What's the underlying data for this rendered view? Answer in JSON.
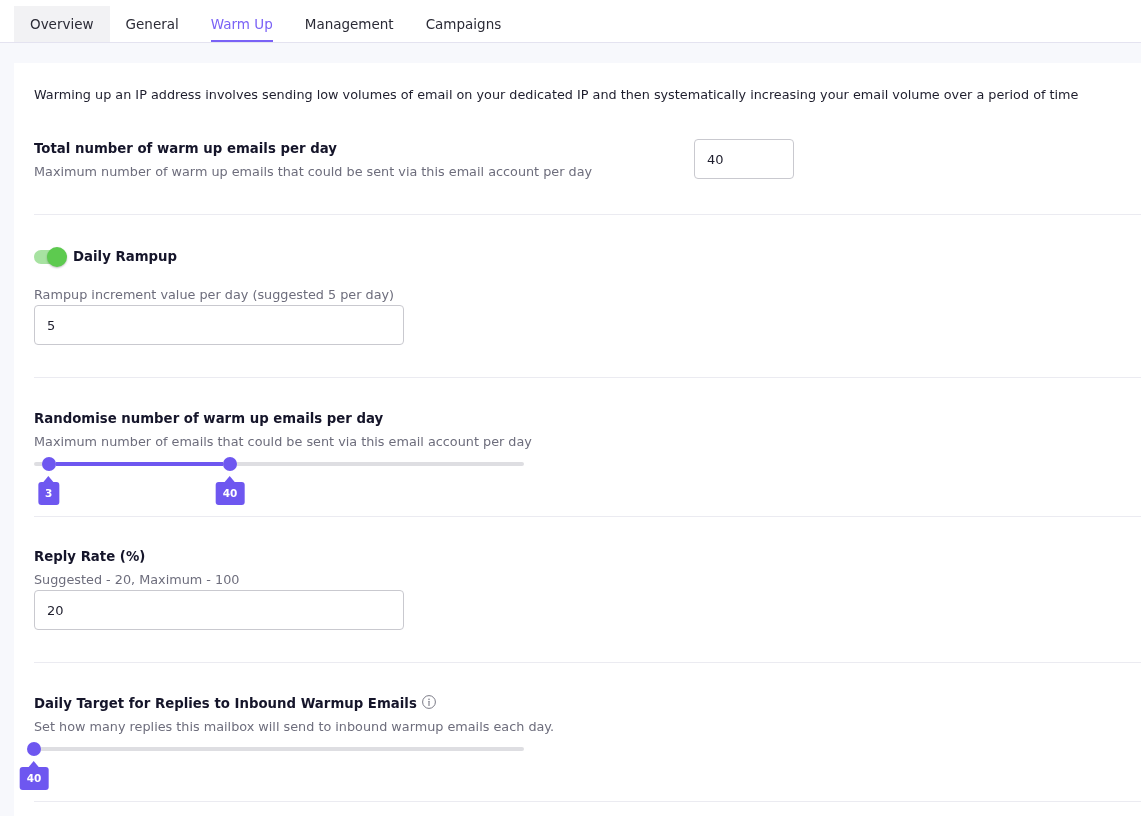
{
  "tabs": [
    {
      "label": "Overview",
      "selected": false,
      "hovered": true
    },
    {
      "label": "General",
      "selected": false,
      "hovered": false
    },
    {
      "label": "Warm Up",
      "selected": true,
      "hovered": false
    },
    {
      "label": "Management",
      "selected": false,
      "hovered": false
    },
    {
      "label": "Campaigns",
      "selected": false,
      "hovered": false
    }
  ],
  "intro": "Warming up an IP address involves sending low volumes of email on your dedicated IP and then systematically increasing your email volume over a period of time",
  "sections": [
    {
      "kind": "field_row",
      "title": "Total number of warm up emails per day",
      "description": "Maximum number of warm up emails that could be sent via this email account per day",
      "value": "40"
    },
    {
      "kind": "toggle_field",
      "label": "Daily Rampup",
      "on": true,
      "field_label": "Rampup increment value per day (suggested 5 per day)",
      "value": "5"
    },
    {
      "kind": "slider",
      "title": "Randomise number of warm up emails per day",
      "description": "Maximum number of emails that could be sent via this email account per day",
      "thumbs": [
        {
          "level": 0.03,
          "value": "3"
        },
        {
          "level": 0.4,
          "value": "40"
        }
      ]
    },
    {
      "kind": "field",
      "title": "Reply Rate (%)",
      "description": "Suggested - 20, Maximum - 100",
      "value": "20"
    },
    {
      "kind": "slider",
      "title": "Daily Target for Replies to Inbound Warmup Emails",
      "info": true,
      "description": "Set how many replies this mailbox will send to inbound warmup emails each day.",
      "thumbs": [
        {
          "level": 0,
          "value": "40"
        }
      ]
    }
  ]
}
